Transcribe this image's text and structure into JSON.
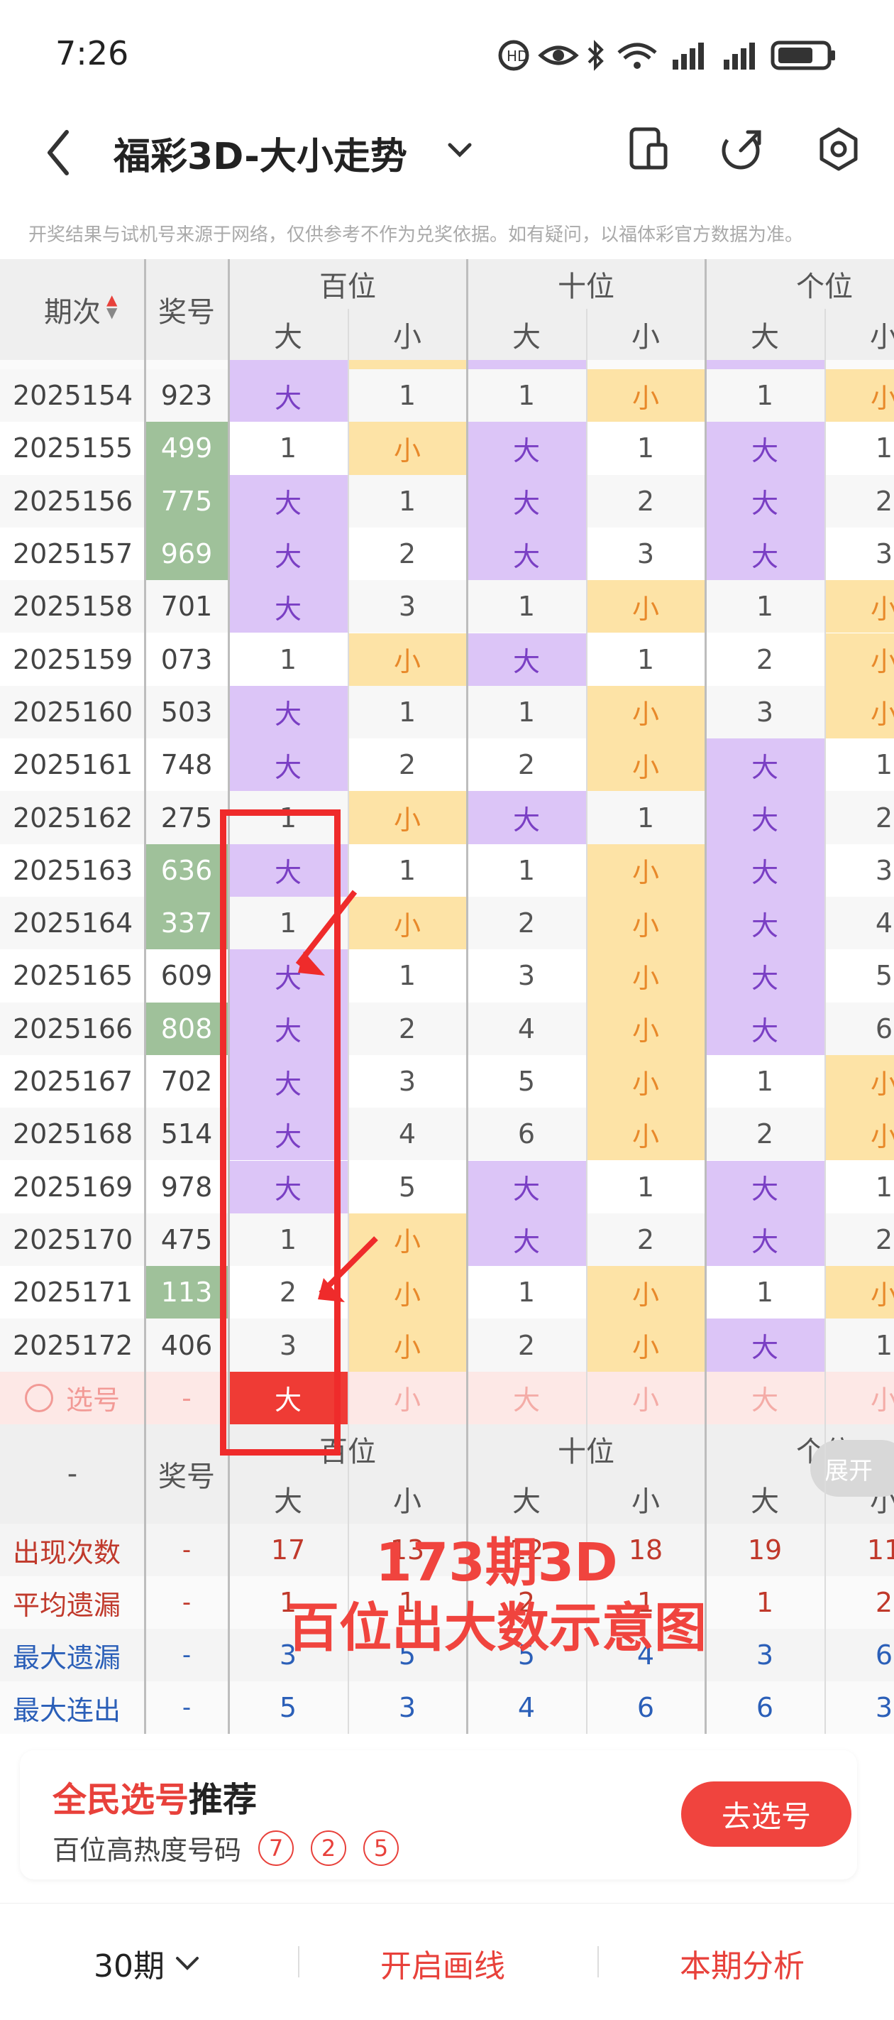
{
  "status_bar": {
    "time": "7:26"
  },
  "header": {
    "title": "福彩3D-大小走势"
  },
  "notice": "开奖结果与试机号来源于网络，仅供参考不作为兑奖依据。如有疑问，以福体彩官方数据为准。",
  "table": {
    "col_period": "期次",
    "col_number": "奖号",
    "groups": [
      "百位",
      "十位",
      "个位"
    ],
    "sub_big": "大",
    "sub_small": "小",
    "rows": [
      {
        "period": "2025154",
        "num": "923",
        "hl": false,
        "c": [
          "大",
          "1",
          "1",
          "小",
          "1",
          "小"
        ]
      },
      {
        "period": "2025155",
        "num": "499",
        "hl": true,
        "c": [
          "1",
          "小",
          "大",
          "1",
          "大",
          "1"
        ]
      },
      {
        "period": "2025156",
        "num": "775",
        "hl": true,
        "c": [
          "大",
          "1",
          "大",
          "2",
          "大",
          "2"
        ]
      },
      {
        "period": "2025157",
        "num": "969",
        "hl": true,
        "c": [
          "大",
          "2",
          "大",
          "3",
          "大",
          "3"
        ]
      },
      {
        "period": "2025158",
        "num": "701",
        "hl": false,
        "c": [
          "大",
          "3",
          "1",
          "小",
          "1",
          "小"
        ]
      },
      {
        "period": "2025159",
        "num": "073",
        "hl": false,
        "c": [
          "1",
          "小",
          "大",
          "1",
          "2",
          "小"
        ]
      },
      {
        "period": "2025160",
        "num": "503",
        "hl": false,
        "c": [
          "大",
          "1",
          "1",
          "小",
          "3",
          "小"
        ]
      },
      {
        "period": "2025161",
        "num": "748",
        "hl": false,
        "c": [
          "大",
          "2",
          "2",
          "小",
          "大",
          "1"
        ]
      },
      {
        "period": "2025162",
        "num": "275",
        "hl": false,
        "c": [
          "1",
          "小",
          "大",
          "1",
          "大",
          "2"
        ]
      },
      {
        "period": "2025163",
        "num": "636",
        "hl": true,
        "c": [
          "大",
          "1",
          "1",
          "小",
          "大",
          "3"
        ]
      },
      {
        "period": "2025164",
        "num": "337",
        "hl": true,
        "c": [
          "1",
          "小",
          "2",
          "小",
          "大",
          "4"
        ]
      },
      {
        "period": "2025165",
        "num": "609",
        "hl": false,
        "c": [
          "大",
          "1",
          "3",
          "小",
          "大",
          "5"
        ]
      },
      {
        "period": "2025166",
        "num": "808",
        "hl": true,
        "c": [
          "大",
          "2",
          "4",
          "小",
          "大",
          "6"
        ]
      },
      {
        "period": "2025167",
        "num": "702",
        "hl": false,
        "c": [
          "大",
          "3",
          "5",
          "小",
          "1",
          "小"
        ]
      },
      {
        "period": "2025168",
        "num": "514",
        "hl": false,
        "c": [
          "大",
          "4",
          "6",
          "小",
          "2",
          "小"
        ]
      },
      {
        "period": "2025169",
        "num": "978",
        "hl": false,
        "c": [
          "大",
          "5",
          "大",
          "1",
          "大",
          "1"
        ]
      },
      {
        "period": "2025170",
        "num": "475",
        "hl": false,
        "c": [
          "1",
          "小",
          "大",
          "2",
          "大",
          "2"
        ]
      },
      {
        "period": "2025171",
        "num": "113",
        "hl": true,
        "c": [
          "2",
          "小",
          "1",
          "小",
          "1",
          "小"
        ]
      },
      {
        "period": "2025172",
        "num": "406",
        "hl": false,
        "c": [
          "3",
          "小",
          "2",
          "小",
          "大",
          "1"
        ]
      }
    ],
    "select_row": {
      "label": "选号",
      "num": "-",
      "c": [
        "大",
        "小",
        "大",
        "小",
        "大",
        "小"
      ]
    },
    "footer_header": {
      "dash": "-",
      "col_number": "奖号",
      "expand": "展开"
    },
    "stats": [
      {
        "label": "出现次数",
        "num": "-",
        "c": [
          "17",
          "13",
          "12",
          "18",
          "19",
          "11"
        ],
        "color": "#c0392b"
      },
      {
        "label": "平均遗漏",
        "num": "-",
        "c": [
          "1",
          "1",
          "2",
          "1",
          "1",
          "2"
        ],
        "color": "#c0392b"
      },
      {
        "label": "最大遗漏",
        "num": "-",
        "c": [
          "3",
          "5",
          "5",
          "4",
          "3",
          "6"
        ],
        "color": "#2b5fb8"
      },
      {
        "label": "最大连出",
        "num": "-",
        "c": [
          "5",
          "3",
          "4",
          "6",
          "6",
          "3"
        ],
        "color": "#2b5fb8"
      }
    ]
  },
  "overlay": {
    "line1": "173期3D",
    "line2": "百位出大数示意图"
  },
  "recommend": {
    "title_red": "全民选号",
    "title_black": "推荐",
    "subtitle": "百位高热度号码",
    "balls": [
      "7",
      "2",
      "5"
    ],
    "button": "去选号"
  },
  "footer": {
    "periods": "30期",
    "draw_line": "开启画线",
    "analysis": "本期分析"
  },
  "colors": {
    "big_bg": "#dcc5f7",
    "small_bg": "#fde3a6",
    "hl_bg": "#9fc19a",
    "accent": "#e8413b"
  }
}
